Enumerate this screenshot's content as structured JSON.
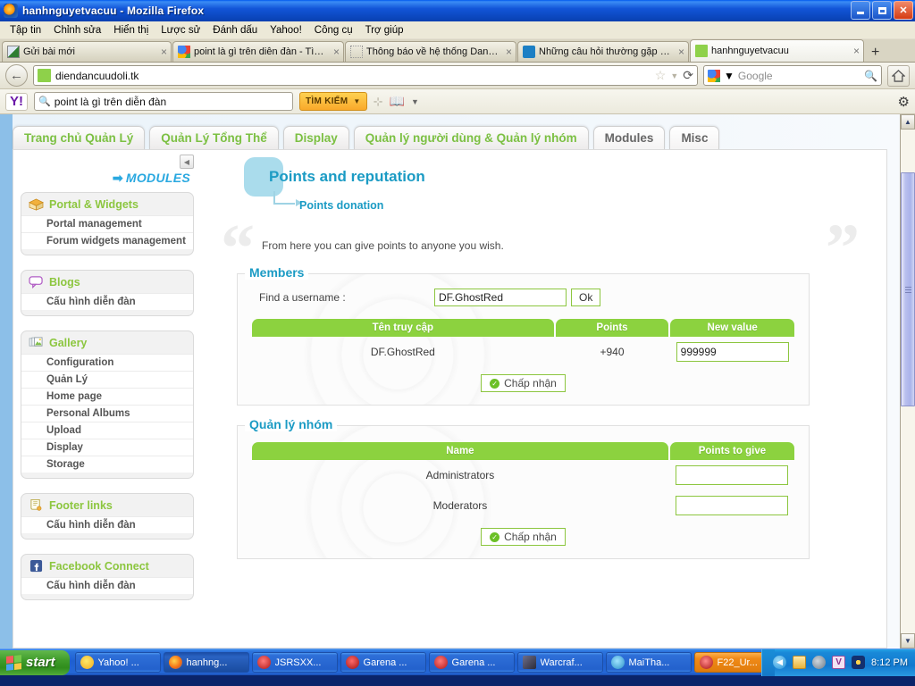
{
  "window": {
    "title": "hanhnguyetvacuu - Mozilla Firefox",
    "minimize_label": "Minimize",
    "maximize_label": "Restore",
    "close_label": "Close"
  },
  "menubar": {
    "items": [
      {
        "label": "Tập tin"
      },
      {
        "label": "Chỉnh sửa"
      },
      {
        "label": "Hiển thị"
      },
      {
        "label": "Lược sử"
      },
      {
        "label": "Đánh dấu"
      },
      {
        "label": "Yahoo!"
      },
      {
        "label": "Công cụ"
      },
      {
        "label": "Trợ giúp"
      }
    ]
  },
  "browser_tabs": {
    "items": [
      {
        "label": "Gửi bài mới",
        "icon": "post-icon",
        "active": false,
        "close": "×"
      },
      {
        "label": "point là gì trên diễn đàn - Tìm ...",
        "icon": "google-icon",
        "active": false,
        "close": "×"
      },
      {
        "label": "Thông báo về hệ thống Danh ...",
        "icon": "generic-icon",
        "active": false,
        "close": "×"
      },
      {
        "label": "Những câu hỏi thường gặp (vấ...",
        "icon": "blue-icon",
        "active": false,
        "close": "×"
      },
      {
        "label": "hanhnguyetvacuu",
        "icon": "forum-icon",
        "active": true,
        "close": "×"
      }
    ],
    "new_tab_label": "+"
  },
  "navbar": {
    "back_label": "←",
    "url": "diendancuudoli.tk",
    "star_icon": "☆",
    "dropdown_icon": "▼",
    "reload_icon": "⟳",
    "search_provider": "Google",
    "search_placeholder": "Google",
    "search_magnifier": "search-icon",
    "home_icon": "home-icon"
  },
  "yahoo_toolbar": {
    "logo": "Y!",
    "search_value": "point là gì  trên diễn đàn",
    "search_button": "TÌM KIẾM",
    "search_button_caret": "▼",
    "separator": "⊹",
    "bookmark_icon": "book-icon",
    "bookmark_caret": "▼",
    "settings_icon": "gear-icon"
  },
  "forum_tabs": {
    "items": [
      {
        "label": "Trang chủ Quản Lý",
        "selected": false
      },
      {
        "label": "Quản Lý Tổng Thể",
        "selected": false
      },
      {
        "label": "Display",
        "selected": false
      },
      {
        "label": "Quản lý người dùng & Quản lý nhóm",
        "selected": false
      },
      {
        "label": "Modules",
        "selected": true
      },
      {
        "label": "Misc",
        "selected": false
      }
    ]
  },
  "sidebar": {
    "collapse_icon": "◀",
    "heading": "MODULES",
    "heading_arrow": "➡",
    "blocks": [
      {
        "title": "Portal & Widgets",
        "icon": "portal-icon",
        "links": [
          "Portal management",
          "Forum widgets management"
        ]
      },
      {
        "title": "Blogs",
        "icon": "blogs-icon",
        "links": [
          "Cấu hình diễn đàn"
        ]
      },
      {
        "title": "Gallery",
        "icon": "gallery-icon",
        "links": [
          "Configuration",
          "Quản Lý",
          "Home page",
          "Personal Albums",
          "Upload",
          "Display",
          "Storage"
        ]
      },
      {
        "title": "Footer links",
        "icon": "footer-icon",
        "links": [
          "Cấu hình diễn đàn"
        ]
      },
      {
        "title": "Facebook Connect",
        "icon": "facebook-icon",
        "links": [
          "Cấu hình diễn đàn"
        ]
      }
    ]
  },
  "main": {
    "title": "Points and reputation",
    "subtitle": "Points donation",
    "quote_open": "“",
    "quote_close": "”",
    "intro_text": "From here you can give points to anyone you wish.",
    "members": {
      "legend": "Members",
      "find_label": "Find a username :",
      "find_value": "DF.GhostRed",
      "find_placeholder": "",
      "ok_button": "Ok",
      "columns": [
        "Tên truy cập",
        "Points",
        "New value"
      ],
      "rows": [
        {
          "username": "DF.GhostRed",
          "points": "+940",
          "new_value": "999999"
        }
      ],
      "accept_button": "Chấp nhận",
      "accept_icon": "check-icon"
    },
    "groups": {
      "legend": "Quản lý nhóm",
      "columns": [
        "Name",
        "Points to give"
      ],
      "rows": [
        {
          "name": "Administrators",
          "points_to_give": ""
        },
        {
          "name": "Moderators",
          "points_to_give": ""
        }
      ],
      "accept_button": "Chấp nhận",
      "accept_icon": "check-icon"
    }
  },
  "scrollbar": {
    "up_icon": "▲",
    "down_icon": "▼"
  },
  "taskbar": {
    "start_label": "start",
    "buttons": [
      {
        "label": "Yahoo! ...",
        "icon": "yahoo-messenger-icon",
        "state": "normal"
      },
      {
        "label": "hanhng...",
        "icon": "firefox-icon",
        "state": "active"
      },
      {
        "label": "JSRSXX...",
        "icon": "garena-icon",
        "state": "normal"
      },
      {
        "label": "Garena ...",
        "icon": "garena-icon",
        "state": "normal"
      },
      {
        "label": "Garena ...",
        "icon": "garena-icon",
        "state": "normal"
      },
      {
        "label": "Warcraf...",
        "icon": "warcraft-icon",
        "state": "normal"
      },
      {
        "label": "MaiTha...",
        "icon": "maitha-icon",
        "state": "normal"
      },
      {
        "label": "F22_Ur...",
        "icon": "garena-icon",
        "state": "highlighted"
      }
    ],
    "tray": {
      "expand_icon": "◀",
      "icons": [
        "mail-icon",
        "volume-icon",
        "antivirus-icon",
        "network-icon"
      ],
      "clock": "8:12 PM"
    }
  },
  "colors": {
    "accent_green": "#8cc63f",
    "accent_blue": "#1b9bc4",
    "table_header": "#8cd23f",
    "titlebar_blue": "#0a44b8"
  }
}
